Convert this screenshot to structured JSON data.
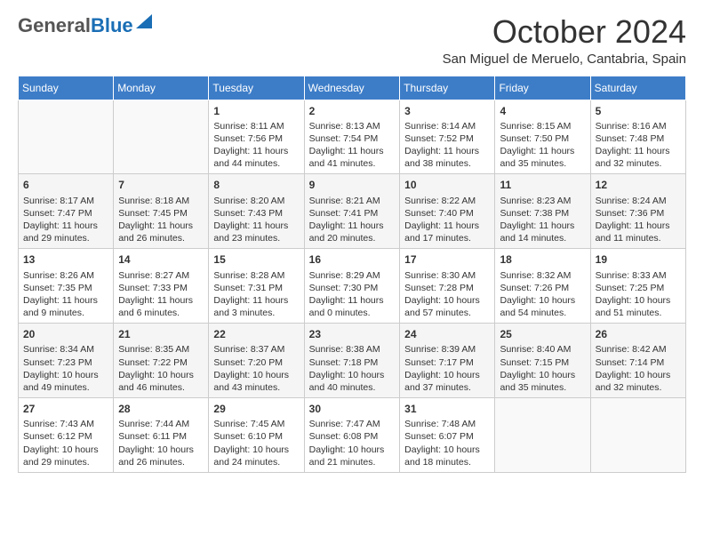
{
  "header": {
    "logo_general": "General",
    "logo_blue": "Blue",
    "month": "October 2024",
    "location": "San Miguel de Meruelo, Cantabria, Spain"
  },
  "weekdays": [
    "Sunday",
    "Monday",
    "Tuesday",
    "Wednesday",
    "Thursday",
    "Friday",
    "Saturday"
  ],
  "weeks": [
    [
      {
        "day": "",
        "info": ""
      },
      {
        "day": "",
        "info": ""
      },
      {
        "day": "1",
        "info": "Sunrise: 8:11 AM\nSunset: 7:56 PM\nDaylight: 11 hours and 44 minutes."
      },
      {
        "day": "2",
        "info": "Sunrise: 8:13 AM\nSunset: 7:54 PM\nDaylight: 11 hours and 41 minutes."
      },
      {
        "day": "3",
        "info": "Sunrise: 8:14 AM\nSunset: 7:52 PM\nDaylight: 11 hours and 38 minutes."
      },
      {
        "day": "4",
        "info": "Sunrise: 8:15 AM\nSunset: 7:50 PM\nDaylight: 11 hours and 35 minutes."
      },
      {
        "day": "5",
        "info": "Sunrise: 8:16 AM\nSunset: 7:48 PM\nDaylight: 11 hours and 32 minutes."
      }
    ],
    [
      {
        "day": "6",
        "info": "Sunrise: 8:17 AM\nSunset: 7:47 PM\nDaylight: 11 hours and 29 minutes."
      },
      {
        "day": "7",
        "info": "Sunrise: 8:18 AM\nSunset: 7:45 PM\nDaylight: 11 hours and 26 minutes."
      },
      {
        "day": "8",
        "info": "Sunrise: 8:20 AM\nSunset: 7:43 PM\nDaylight: 11 hours and 23 minutes."
      },
      {
        "day": "9",
        "info": "Sunrise: 8:21 AM\nSunset: 7:41 PM\nDaylight: 11 hours and 20 minutes."
      },
      {
        "day": "10",
        "info": "Sunrise: 8:22 AM\nSunset: 7:40 PM\nDaylight: 11 hours and 17 minutes."
      },
      {
        "day": "11",
        "info": "Sunrise: 8:23 AM\nSunset: 7:38 PM\nDaylight: 11 hours and 14 minutes."
      },
      {
        "day": "12",
        "info": "Sunrise: 8:24 AM\nSunset: 7:36 PM\nDaylight: 11 hours and 11 minutes."
      }
    ],
    [
      {
        "day": "13",
        "info": "Sunrise: 8:26 AM\nSunset: 7:35 PM\nDaylight: 11 hours and 9 minutes."
      },
      {
        "day": "14",
        "info": "Sunrise: 8:27 AM\nSunset: 7:33 PM\nDaylight: 11 hours and 6 minutes."
      },
      {
        "day": "15",
        "info": "Sunrise: 8:28 AM\nSunset: 7:31 PM\nDaylight: 11 hours and 3 minutes."
      },
      {
        "day": "16",
        "info": "Sunrise: 8:29 AM\nSunset: 7:30 PM\nDaylight: 11 hours and 0 minutes."
      },
      {
        "day": "17",
        "info": "Sunrise: 8:30 AM\nSunset: 7:28 PM\nDaylight: 10 hours and 57 minutes."
      },
      {
        "day": "18",
        "info": "Sunrise: 8:32 AM\nSunset: 7:26 PM\nDaylight: 10 hours and 54 minutes."
      },
      {
        "day": "19",
        "info": "Sunrise: 8:33 AM\nSunset: 7:25 PM\nDaylight: 10 hours and 51 minutes."
      }
    ],
    [
      {
        "day": "20",
        "info": "Sunrise: 8:34 AM\nSunset: 7:23 PM\nDaylight: 10 hours and 49 minutes."
      },
      {
        "day": "21",
        "info": "Sunrise: 8:35 AM\nSunset: 7:22 PM\nDaylight: 10 hours and 46 minutes."
      },
      {
        "day": "22",
        "info": "Sunrise: 8:37 AM\nSunset: 7:20 PM\nDaylight: 10 hours and 43 minutes."
      },
      {
        "day": "23",
        "info": "Sunrise: 8:38 AM\nSunset: 7:18 PM\nDaylight: 10 hours and 40 minutes."
      },
      {
        "day": "24",
        "info": "Sunrise: 8:39 AM\nSunset: 7:17 PM\nDaylight: 10 hours and 37 minutes."
      },
      {
        "day": "25",
        "info": "Sunrise: 8:40 AM\nSunset: 7:15 PM\nDaylight: 10 hours and 35 minutes."
      },
      {
        "day": "26",
        "info": "Sunrise: 8:42 AM\nSunset: 7:14 PM\nDaylight: 10 hours and 32 minutes."
      }
    ],
    [
      {
        "day": "27",
        "info": "Sunrise: 7:43 AM\nSunset: 6:12 PM\nDaylight: 10 hours and 29 minutes."
      },
      {
        "day": "28",
        "info": "Sunrise: 7:44 AM\nSunset: 6:11 PM\nDaylight: 10 hours and 26 minutes."
      },
      {
        "day": "29",
        "info": "Sunrise: 7:45 AM\nSunset: 6:10 PM\nDaylight: 10 hours and 24 minutes."
      },
      {
        "day": "30",
        "info": "Sunrise: 7:47 AM\nSunset: 6:08 PM\nDaylight: 10 hours and 21 minutes."
      },
      {
        "day": "31",
        "info": "Sunrise: 7:48 AM\nSunset: 6:07 PM\nDaylight: 10 hours and 18 minutes."
      },
      {
        "day": "",
        "info": ""
      },
      {
        "day": "",
        "info": ""
      }
    ]
  ]
}
